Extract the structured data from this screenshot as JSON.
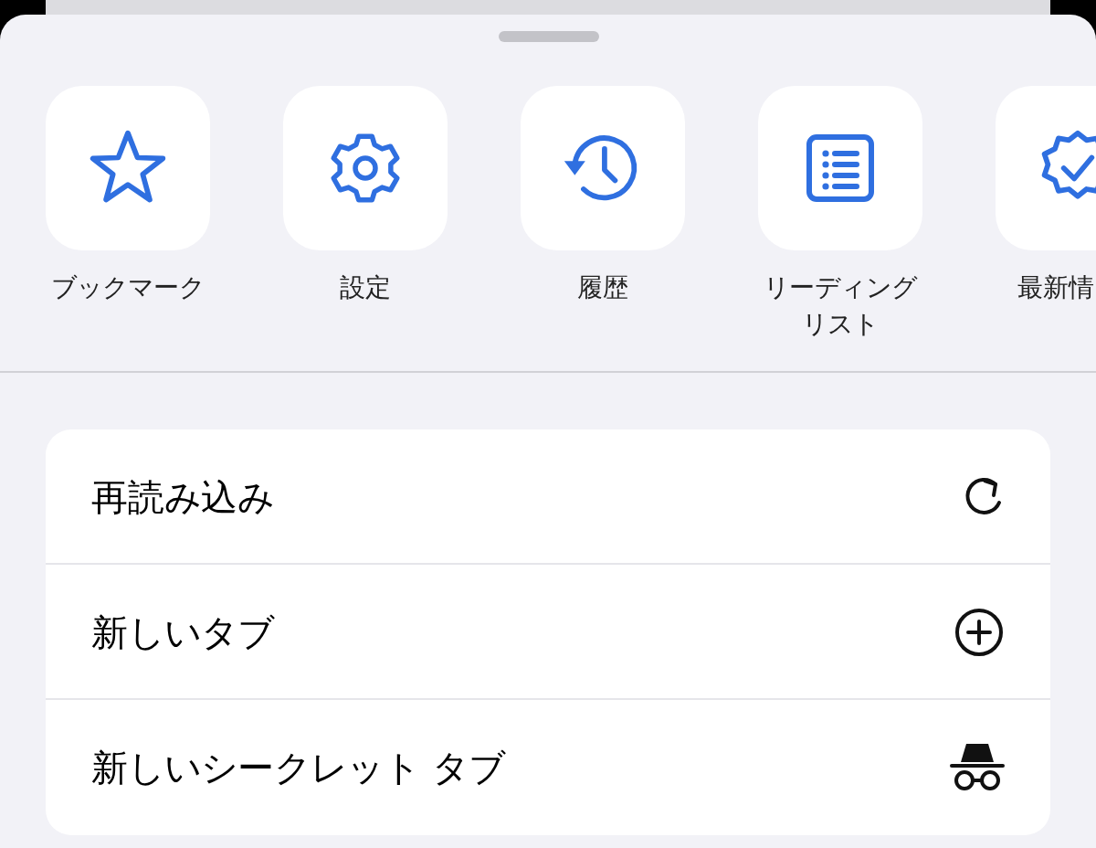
{
  "shortcuts": [
    {
      "kind": "star",
      "label": "ブックマーク"
    },
    {
      "kind": "gear",
      "label": "設定"
    },
    {
      "kind": "history",
      "label": "履歴"
    },
    {
      "kind": "list",
      "label": "リーディングリスト"
    },
    {
      "kind": "badge",
      "label": "最新情"
    }
  ],
  "menu": [
    {
      "kind": "reload",
      "label": "再読み込み"
    },
    {
      "kind": "plus",
      "label": "新しいタブ"
    },
    {
      "kind": "incognito",
      "label": "新しいシークレット タブ"
    }
  ]
}
